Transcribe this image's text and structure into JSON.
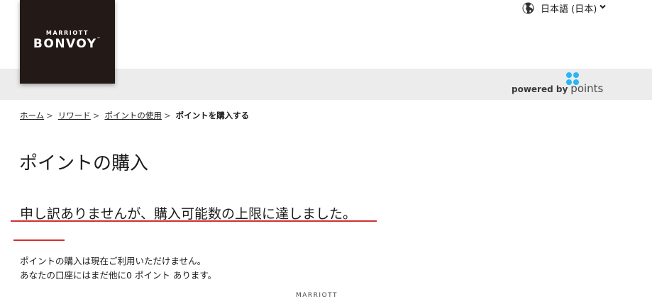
{
  "header": {
    "logo_top": "MARRIOTT",
    "logo_main": "BONVOY",
    "logo_tm": "™",
    "language_label": "日本語 (日本)",
    "powered_by": "powered by",
    "points_brand": "points"
  },
  "breadcrumb": {
    "items": [
      "ホーム",
      "リワード",
      "ポイントの使用"
    ],
    "separator": ">",
    "current": "ポイントを購入する"
  },
  "main": {
    "title": "ポイントの購入",
    "error_message": "申し訳ありませんが、購入可能数の上限に達しました。",
    "info_line1": "ポイントの購入は現在ご利用いただけません。",
    "info_line2": "あなたの口座にはまだ他に0 ポイント あります。"
  },
  "footer": {
    "logo_partial": "MARRIOTT"
  },
  "colors": {
    "logo_bg": "#231a17",
    "band_gray": "#ececec",
    "annotation_red": "#d32f2f",
    "points_blue": "#29b6f6"
  },
  "icons": [
    "globe-icon",
    "chevron-down-icon",
    "points-dots-icon"
  ]
}
